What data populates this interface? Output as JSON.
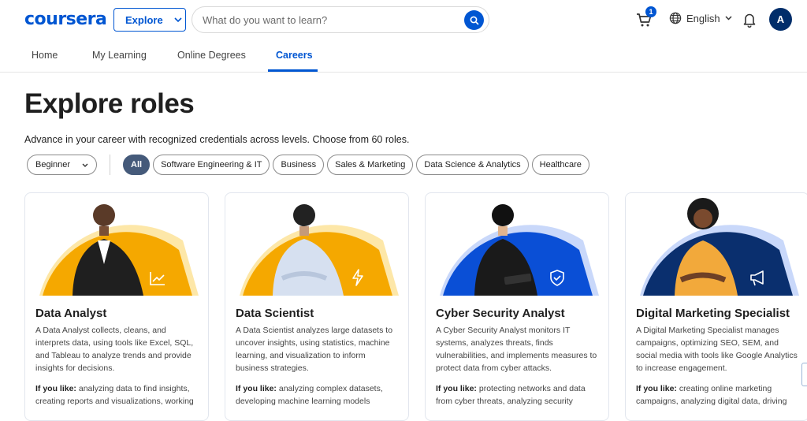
{
  "header": {
    "logo": "coursera",
    "explore_label": "Explore",
    "search_placeholder": "What do you want to learn?",
    "cart_count": "1",
    "language": "English",
    "avatar_initial": "A"
  },
  "nav": {
    "items": [
      "Home",
      "My Learning",
      "Online Degrees",
      "Careers"
    ],
    "active": "Careers"
  },
  "page": {
    "title": "Explore roles",
    "subtitle": "Advance in your career with recognized credentials across levels. Choose from 60 roles."
  },
  "filters": {
    "level": "Beginner",
    "chips": [
      "All",
      "Software Engineering & IT",
      "Business",
      "Sales & Marketing",
      "Data Science & Analytics",
      "Healthcare"
    ],
    "active_chip": "All"
  },
  "cards": [
    {
      "title": "Data Analyst",
      "description": "A Data Analyst collects, cleans, and interprets data, using tools like Excel, SQL, and Tableau to analyze trends and provide insights for decisions.",
      "like_label": "If you like:",
      "like_text": "analyzing data to find insights, creating reports and visualizations, working",
      "icon": "chart-line-icon",
      "accent": "#f5a800"
    },
    {
      "title": "Data Scientist",
      "description": "A Data Scientist analyzes large datasets to uncover insights, using statistics, machine learning, and visualization to inform business strategies.",
      "like_label": "If you like:",
      "like_text": "analyzing complex datasets, developing machine learning models",
      "icon": "lightning-icon",
      "accent": "#f5a800"
    },
    {
      "title": "Cyber Security Analyst",
      "description": "A Cyber Security Analyst monitors IT systems, analyzes threats, finds vulnerabilities, and implements measures to protect data from cyber attacks.",
      "like_label": "If you like:",
      "like_text": "protecting networks and data from cyber threats, analyzing security",
      "icon": "shield-check-icon",
      "accent": "#0a4fd6"
    },
    {
      "title": "Digital Marketing Specialist",
      "description": "A Digital Marketing Specialist manages campaigns, optimizing SEO, SEM, and social media with tools like Google Analytics to increase engagement.",
      "like_label": "If you like:",
      "like_text": "creating online marketing campaigns, analyzing digital data, driving",
      "icon": "megaphone-icon",
      "accent": "#0a2f6e"
    }
  ]
}
